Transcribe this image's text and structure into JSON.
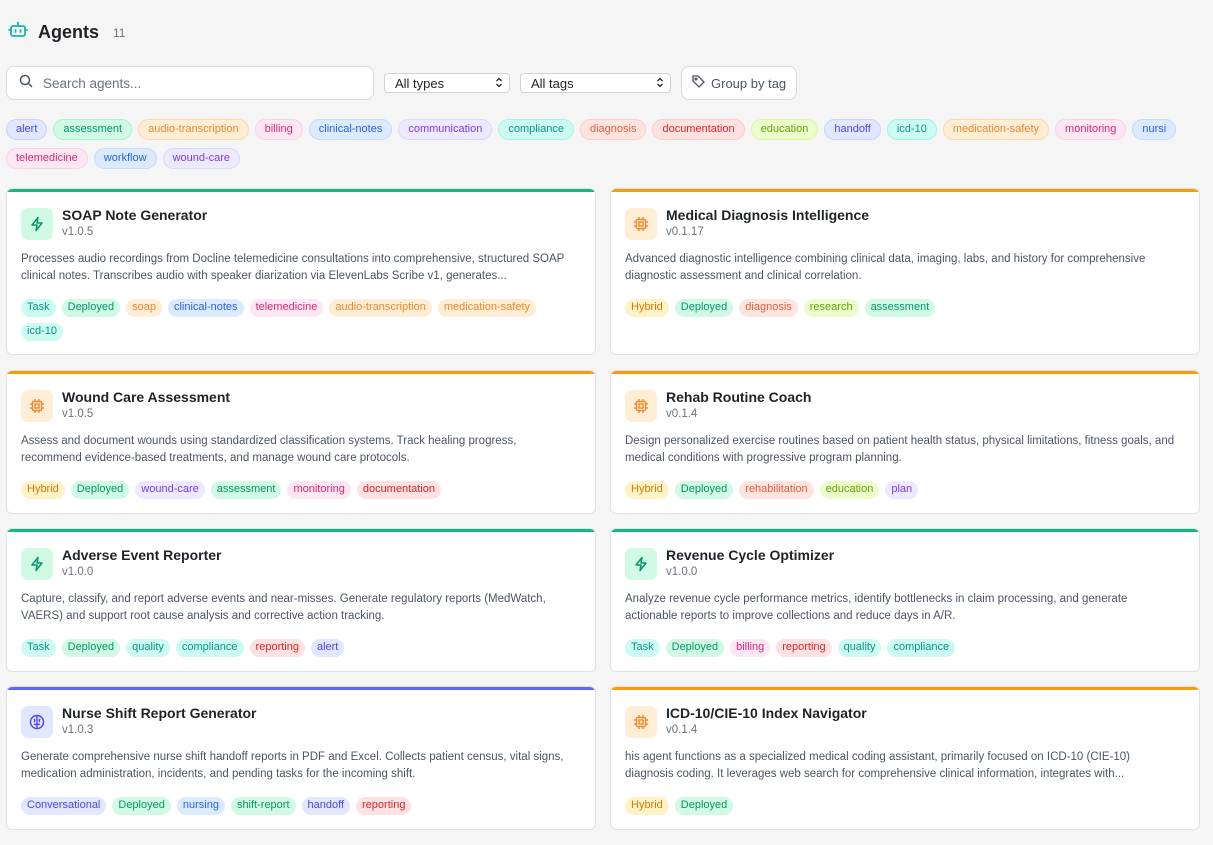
{
  "header": {
    "title": "Agents",
    "count": "11",
    "icon": "robot-icon",
    "accent": "#14b8a6"
  },
  "controls": {
    "search_placeholder": "Search agents...",
    "types_value": "All types",
    "tags_value": "All tags",
    "group_label": "Group by tag"
  },
  "filter_tags_row1": [
    "alert",
    "assessment",
    "audio-transcription",
    "billing",
    "clinical-notes",
    "communication",
    "compliance",
    "diagnosis",
    "documentation",
    "education",
    "handoff",
    "icd-10",
    "medication-safety",
    "monitoring",
    "nursi"
  ],
  "filter_tags_row2": [
    "telemedicine",
    "workflow",
    "wound-care"
  ],
  "colors": {
    "task": "#10b981",
    "hybrid": "#f59e0b",
    "conversational": "#6366f1"
  },
  "agents": [
    {
      "name": "SOAP Note Generator",
      "version": "v1.0.5",
      "kind": "task",
      "description": "Processes audio recordings from Docline telemedicine consultations into comprehensive, structured SOAP clinical notes. Transcribes audio with speaker diarization via ElevenLabs Scribe v1, generates...",
      "tags": [
        "Task",
        "Deployed",
        "soap",
        "clinical-notes",
        "telemedicine",
        "audio-transcription",
        "medication-safety",
        "icd-10"
      ]
    },
    {
      "name": "Medical Diagnosis Intelligence",
      "version": "v0.1.17",
      "kind": "hybrid",
      "description": "Advanced diagnostic intelligence combining clinical data, imaging, labs, and history for comprehensive diagnostic assessment and clinical correlation.",
      "tags": [
        "Hybrid",
        "Deployed",
        "diagnosis",
        "research",
        "assessment"
      ]
    },
    {
      "name": "Wound Care Assessment",
      "version": "v1.0.5",
      "kind": "hybrid",
      "description": "Assess and document wounds using standardized classification systems. Track healing progress, recommend evidence-based treatments, and manage wound care protocols.",
      "tags": [
        "Hybrid",
        "Deployed",
        "wound-care",
        "assessment",
        "monitoring",
        "documentation"
      ]
    },
    {
      "name": "Rehab Routine Coach",
      "version": "v0.1.4",
      "kind": "hybrid",
      "description": "Design personalized exercise routines based on patient health status, physical limitations, fitness goals, and medical conditions with progressive program planning.",
      "tags": [
        "Hybrid",
        "Deployed",
        "rehabilitation",
        "education",
        "plan"
      ]
    },
    {
      "name": "Adverse Event Reporter",
      "version": "v1.0.0",
      "kind": "task",
      "description": "Capture, classify, and report adverse events and near-misses. Generate regulatory reports (MedWatch, VAERS) and support root cause analysis and corrective action tracking.",
      "tags": [
        "Task",
        "Deployed",
        "quality",
        "compliance",
        "reporting",
        "alert"
      ]
    },
    {
      "name": "Revenue Cycle Optimizer",
      "version": "v1.0.0",
      "kind": "task",
      "description": "Analyze revenue cycle performance metrics, identify bottlenecks in claim processing, and generate actionable reports to improve collections and reduce days in A/R.",
      "tags": [
        "Task",
        "Deployed",
        "billing",
        "reporting",
        "quality",
        "compliance"
      ]
    },
    {
      "name": "Nurse Shift Report Generator",
      "version": "v1.0.3",
      "kind": "conversational",
      "description": "Generate comprehensive nurse shift handoff reports in PDF and Excel. Collects patient census, vital signs, medication administration, incidents, and pending tasks for the incoming shift.",
      "tags": [
        "Conversational",
        "Deployed",
        "nursing",
        "shift-report",
        "handoff",
        "reporting"
      ]
    },
    {
      "name": "ICD-10/CIE-10 Index Navigator",
      "version": "v0.1.4",
      "kind": "hybrid",
      "description": "his agent functions as a specialized medical coding assistant, primarily focused on ICD-10 (CIE-10) diagnosis coding. It leverages web search for comprehensive clinical information, integrates with...",
      "tags": [
        "Hybrid",
        "Deployed"
      ]
    }
  ]
}
